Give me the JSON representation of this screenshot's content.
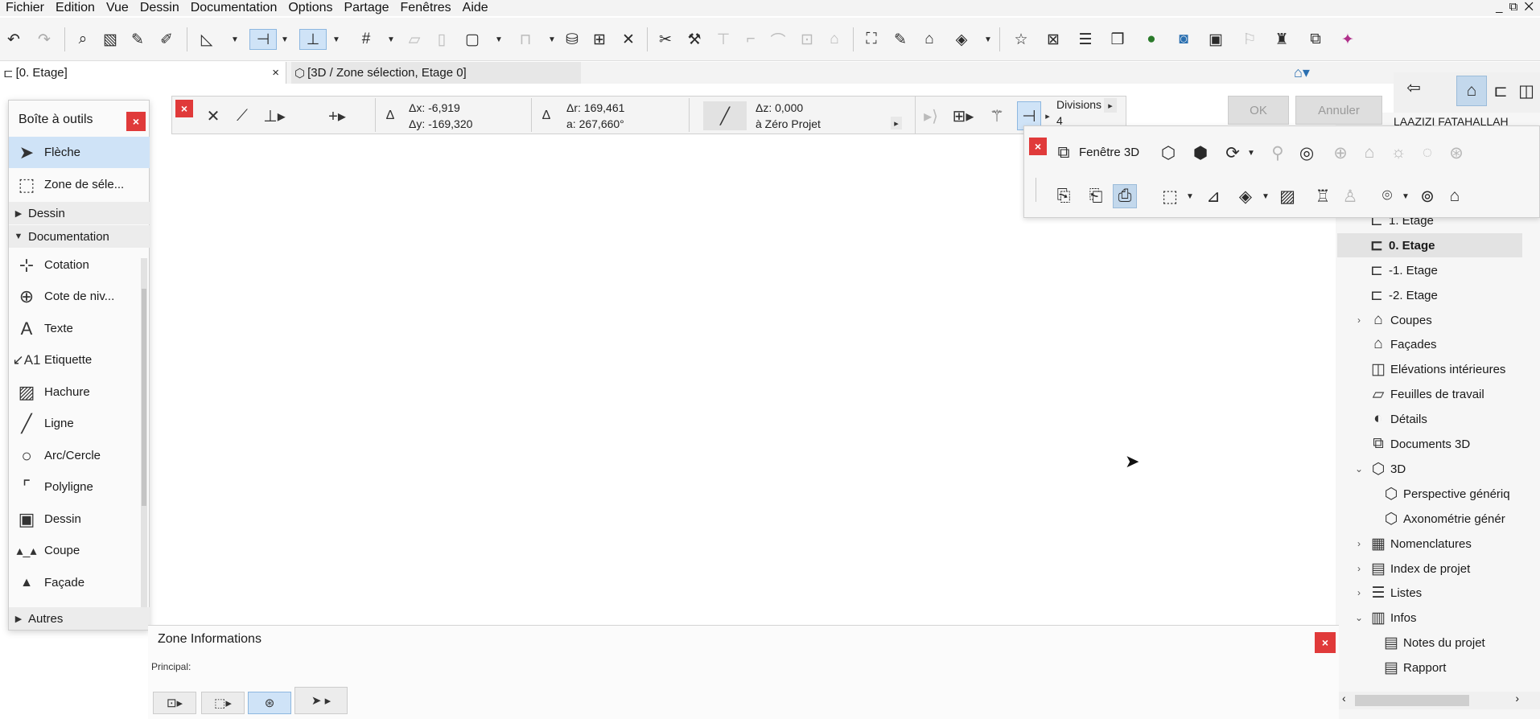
{
  "menu": [
    "Fichier",
    "Edition",
    "Vue",
    "Dessin",
    "Documentation",
    "Options",
    "Partage",
    "Fenêtres",
    "Aide"
  ],
  "window_controls": "_ ⧉ ✕",
  "tabs": [
    {
      "label": "[0. Etage]",
      "close": "×"
    },
    {
      "label": "[3D / Zone sélection, Etage 0]"
    }
  ],
  "toolbox": {
    "title": "Boîte à outils",
    "close": "×",
    "tools_top": [
      {
        "label": "Flèche",
        "icon": "arrow-pointer-icon"
      },
      {
        "label": "Zone de séle...",
        "icon": "marquee-icon"
      }
    ],
    "sections": {
      "dessin": "Dessin",
      "documentation": "Documentation",
      "autres": "Autres"
    },
    "doc_tools": [
      {
        "label": "Cotation",
        "icon": "dimension-icon"
      },
      {
        "label": "Cote de niv...",
        "icon": "level-dimension-icon"
      },
      {
        "label": "Texte",
        "icon": "text-icon"
      },
      {
        "label": "Etiquette",
        "icon": "label-icon"
      },
      {
        "label": "Hachure",
        "icon": "fill-icon"
      },
      {
        "label": "Ligne",
        "icon": "line-icon"
      },
      {
        "label": "Arc/Cercle",
        "icon": "arc-icon"
      },
      {
        "label": "Polyligne",
        "icon": "polyline-icon"
      },
      {
        "label": "Dessin",
        "icon": "drawing-icon"
      },
      {
        "label": "Coupe",
        "icon": "section-icon"
      },
      {
        "label": "Façade",
        "icon": "elevation-icon"
      }
    ]
  },
  "coords": {
    "dx": "Δx: -6,919",
    "dy": "Δy: -169,320",
    "dr": "Δr: 169,461",
    "da": "a: 267,660°",
    "dz": "Δz: 0,000",
    "ref": "à Zéro Projet",
    "divisions_label": "Divisions",
    "divisions_value": "4",
    "ok": "OK",
    "cancel": "Annuler"
  },
  "user": "LAAZIZI FATAHALLAH",
  "panel3d": {
    "title": "Fenêtre 3D",
    "close": "×"
  },
  "navigator": [
    {
      "label": "1. Etage",
      "indent": 2,
      "icon": "story-icon"
    },
    {
      "label": "0. Etage",
      "indent": 2,
      "icon": "story-icon",
      "selected": true
    },
    {
      "label": "-1. Etage",
      "indent": 2,
      "icon": "story-icon"
    },
    {
      "label": "-2. Etage",
      "indent": 2,
      "icon": "story-icon"
    },
    {
      "label": "Coupes",
      "indent": 1,
      "icon": "section-folder-icon",
      "twisty": "›"
    },
    {
      "label": "Façades",
      "indent": 1,
      "icon": "elevation-folder-icon"
    },
    {
      "label": "Elévations intérieures",
      "indent": 1,
      "icon": "interior-elevation-icon"
    },
    {
      "label": "Feuilles de travail",
      "indent": 1,
      "icon": "worksheet-icon"
    },
    {
      "label": "Détails",
      "indent": 1,
      "icon": "detail-icon"
    },
    {
      "label": "Documents 3D",
      "indent": 1,
      "icon": "document-3d-icon"
    },
    {
      "label": "3D",
      "indent": 1,
      "icon": "cube-icon",
      "twisty": "⌄"
    },
    {
      "label": "Perspective génériq",
      "indent": 2,
      "icon": "perspective-icon"
    },
    {
      "label": "Axonométrie génér",
      "indent": 2,
      "icon": "axonometry-icon"
    },
    {
      "label": "Nomenclatures",
      "indent": 1,
      "icon": "schedule-icon",
      "twisty": "›"
    },
    {
      "label": "Index de projet",
      "indent": 1,
      "icon": "index-icon",
      "twisty": "›"
    },
    {
      "label": "Listes",
      "indent": 1,
      "icon": "list-icon",
      "twisty": "›"
    },
    {
      "label": "Infos",
      "indent": 1,
      "icon": "info-icon",
      "twisty": "⌄"
    },
    {
      "label": "Notes du projet",
      "indent": 2,
      "icon": "notes-icon"
    },
    {
      "label": "Rapport",
      "indent": 2,
      "icon": "report-icon"
    }
  ],
  "info_zone": {
    "title": "Zone Informations",
    "subtitle": "Principal:",
    "close": "×"
  }
}
